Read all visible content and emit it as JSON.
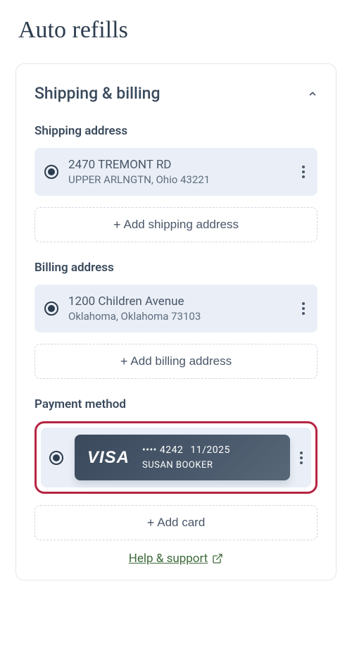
{
  "pageTitle": "Auto refills",
  "section": {
    "title": "Shipping & billing",
    "shipping": {
      "label": "Shipping address",
      "address": {
        "line1": "2470 TREMONT RD",
        "line2": "UPPER ARLNGTN, Ohio 43221"
      },
      "addButton": "Add shipping address"
    },
    "billing": {
      "label": "Billing address",
      "address": {
        "line1": "1200 Children Avenue",
        "line2": "Oklahoma, Oklahoma 73103"
      },
      "addButton": "Add billing address"
    },
    "payment": {
      "label": "Payment method",
      "card": {
        "brand": "VISA",
        "masked": "•••• 4242",
        "expiry": "11/2025",
        "holder": "SUSAN BOOKER"
      },
      "addButton": "Add card"
    }
  },
  "helpLink": "Help & support"
}
